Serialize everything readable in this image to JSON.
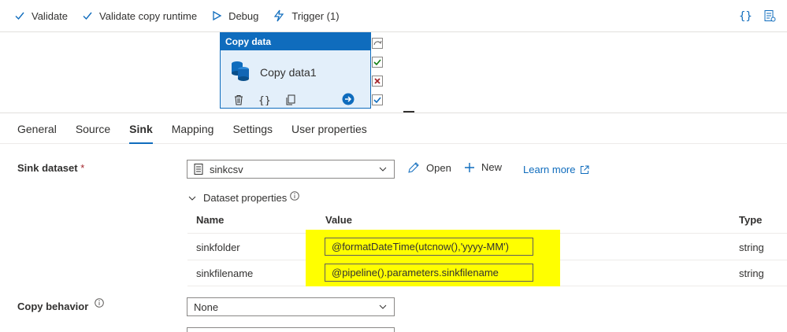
{
  "toolbar": {
    "validate": "Validate",
    "validate_copy_runtime": "Validate copy runtime",
    "debug": "Debug",
    "trigger": "Trigger (1)"
  },
  "activity": {
    "header": "Copy data",
    "name": "Copy data1"
  },
  "tabs": [
    "General",
    "Source",
    "Sink",
    "Mapping",
    "Settings",
    "User properties"
  ],
  "active_tab": "Sink",
  "sink": {
    "dataset_label": "Sink dataset",
    "required_mark": "*",
    "dataset_value": "sinkcsv",
    "open_label": "Open",
    "new_label": "New",
    "learn_more": "Learn more",
    "dataset_properties_label": "Dataset properties",
    "columns": {
      "name": "Name",
      "value": "Value",
      "type": "Type"
    },
    "rows": [
      {
        "name": "sinkfolder",
        "value": "@formatDateTime(utcnow(),'yyyy-MM')",
        "type": "string"
      },
      {
        "name": "sinkfilename",
        "value": "@pipeline().parameters.sinkfilename",
        "type": "string"
      }
    ],
    "copy_behavior_label": "Copy behavior",
    "copy_behavior_value": "None"
  },
  "colors": {
    "accent": "#0f6cbd",
    "highlight": "#ffff00",
    "success": "#107c10",
    "fail": "#a4262c"
  }
}
